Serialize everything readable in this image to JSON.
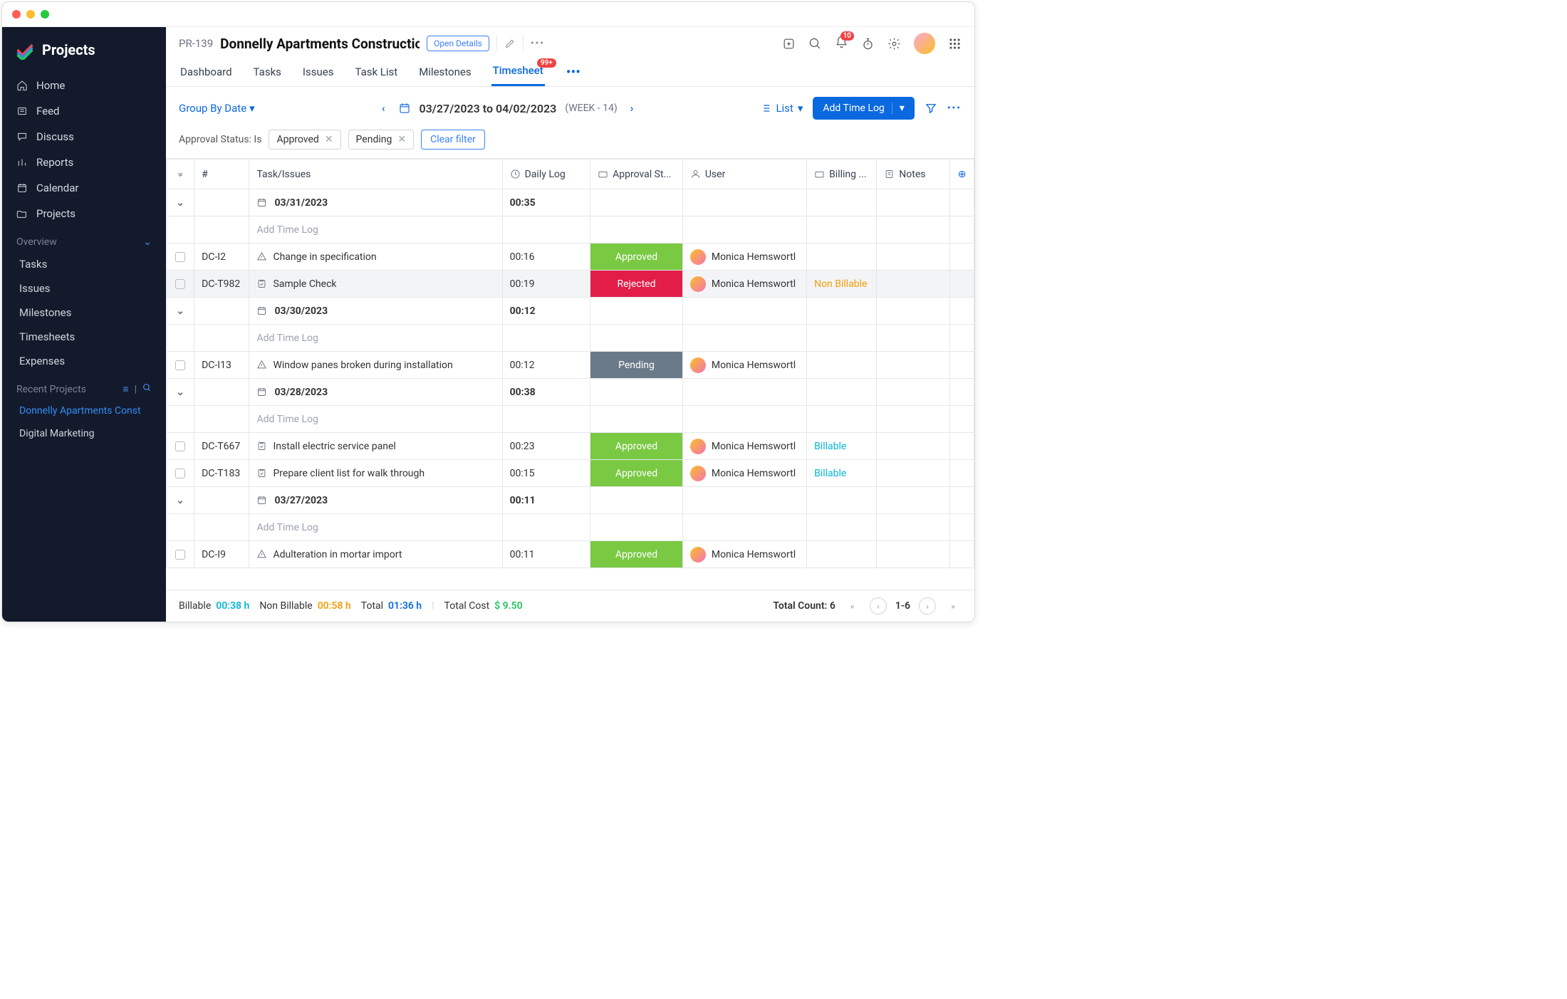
{
  "brand": "Projects",
  "sidebar": {
    "nav": [
      {
        "icon": "home",
        "label": "Home"
      },
      {
        "icon": "feed",
        "label": "Feed"
      },
      {
        "icon": "discuss",
        "label": "Discuss"
      },
      {
        "icon": "reports",
        "label": "Reports"
      },
      {
        "icon": "calendar",
        "label": "Calendar"
      },
      {
        "icon": "projects",
        "label": "Projects"
      }
    ],
    "overview_label": "Overview",
    "overview_items": [
      "Tasks",
      "Issues",
      "Milestones",
      "Timesheets",
      "Expenses"
    ],
    "recent_label": "Recent Projects",
    "recent_items": [
      {
        "label": "Donnelly Apartments Const",
        "active": true
      },
      {
        "label": "Digital Marketing",
        "active": false
      }
    ]
  },
  "header": {
    "project_id": "PR-139",
    "project_title": "Donnelly Apartments Constructio",
    "open_details": "Open Details",
    "tabs": [
      "Dashboard",
      "Tasks",
      "Issues",
      "Task List",
      "Milestones",
      "Timesheet"
    ],
    "active_tab": "Timesheet",
    "timesheet_badge": "99+",
    "notif_badge": "10"
  },
  "toolbar": {
    "group_by": "Group By Date",
    "date_range": "03/27/2023 to 04/02/2023",
    "week_label": "(WEEK - 14)",
    "view_label": "List",
    "add_btn": "Add Time Log"
  },
  "filters": {
    "label": "Approval Status: Is",
    "chips": [
      "Approved",
      "Pending"
    ],
    "clear": "Clear filter"
  },
  "columns": {
    "num": "#",
    "task": "Task/Issues",
    "daily": "Daily Log",
    "approval": "Approval St...",
    "user": "User",
    "billing": "Billing ...",
    "notes": "Notes"
  },
  "add_time_log_label": "Add Time Log",
  "rows": [
    {
      "type": "date",
      "date": "03/31/2023",
      "daily": "00:35"
    },
    {
      "type": "add"
    },
    {
      "type": "item",
      "num": "DC-I2",
      "kind": "issue",
      "task": "Change in specification",
      "daily": "00:16",
      "status": "Approved",
      "user": "Monica Hemswortl",
      "billing": ""
    },
    {
      "type": "item",
      "num": "DC-T982",
      "kind": "task",
      "task": "Sample Check",
      "daily": "00:19",
      "status": "Rejected",
      "user": "Monica Hemswortl",
      "billing": "Non Billable",
      "selected": true
    },
    {
      "type": "date",
      "date": "03/30/2023",
      "daily": "00:12"
    },
    {
      "type": "add"
    },
    {
      "type": "item",
      "num": "DC-I13",
      "kind": "issue",
      "task": "Window panes broken during installation",
      "daily": "00:12",
      "status": "Pending",
      "user": "Monica Hemswortl",
      "billing": ""
    },
    {
      "type": "date",
      "date": "03/28/2023",
      "daily": "00:38"
    },
    {
      "type": "add"
    },
    {
      "type": "item",
      "num": "DC-T667",
      "kind": "task",
      "task": "Install electric service panel",
      "daily": "00:23",
      "status": "Approved",
      "user": "Monica Hemswortl",
      "billing": "Billable"
    },
    {
      "type": "item",
      "num": "DC-T183",
      "kind": "task",
      "task": "Prepare client list for walk through",
      "daily": "00:15",
      "status": "Approved",
      "user": "Monica Hemswortl",
      "billing": "Billable"
    },
    {
      "type": "date",
      "date": "03/27/2023",
      "daily": "00:11"
    },
    {
      "type": "add"
    },
    {
      "type": "item",
      "num": "DC-I9",
      "kind": "issue",
      "task": "Adulteration in mortar import",
      "daily": "00:11",
      "status": "Approved",
      "user": "Monica Hemswortl",
      "billing": ""
    }
  ],
  "footer": {
    "billable_label": "Billable",
    "billable_val": "00:38 h",
    "nonbillable_label": "Non Billable",
    "nonbillable_val": "00:58 h",
    "total_label": "Total",
    "total_val": "01:36 h",
    "cost_label": "Total Cost",
    "cost_val": "$ 9.50",
    "count_label": "Total Count: 6",
    "range": "1-6"
  }
}
